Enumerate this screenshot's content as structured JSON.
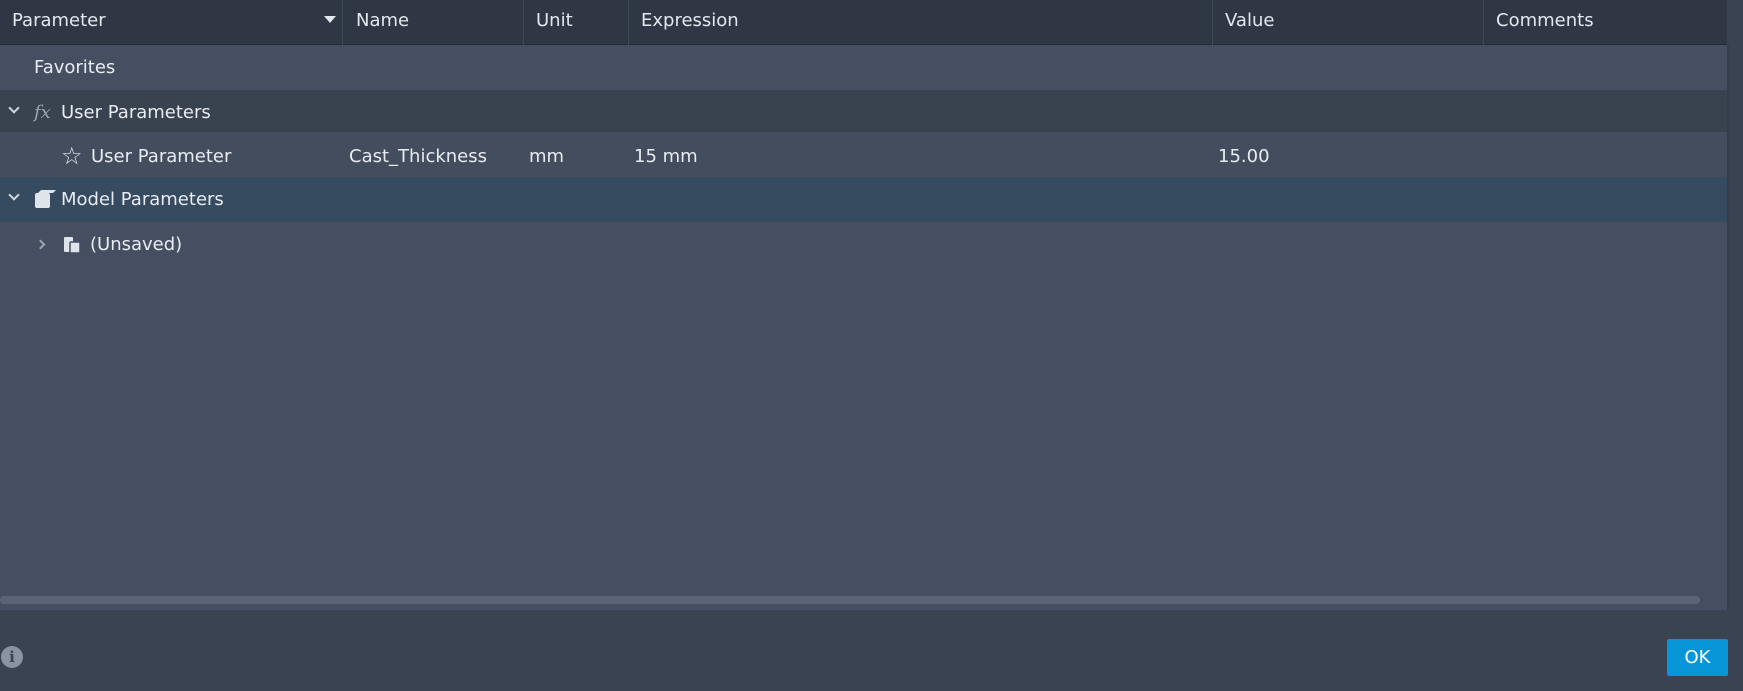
{
  "columns": {
    "parameter": "Parameter",
    "name": "Name",
    "unit": "Unit",
    "expression": "Expression",
    "value": "Value",
    "comments": "Comments"
  },
  "rows": {
    "favorites": {
      "label": "Favorites"
    },
    "user_parameters": {
      "label": "User Parameters",
      "icon": "fx-icon"
    },
    "user_parameter": {
      "label": "User Parameter",
      "name": "Cast_Thickness",
      "unit": "mm",
      "expression": "15 mm",
      "value": "15.00",
      "comments": "",
      "icon": "star-outline-icon"
    },
    "model_parameters": {
      "label": "Model Parameters",
      "icon": "cube-icon"
    },
    "unsaved": {
      "label": "(Unsaved)",
      "icon": "document-icon"
    }
  },
  "footer": {
    "ok_label": "OK",
    "info_icon": "info-icon"
  },
  "colors": {
    "accent": "#0696d7",
    "header_bg": "#2f3744",
    "body_bg": "#454f61",
    "selected_row": "#364b5f"
  }
}
